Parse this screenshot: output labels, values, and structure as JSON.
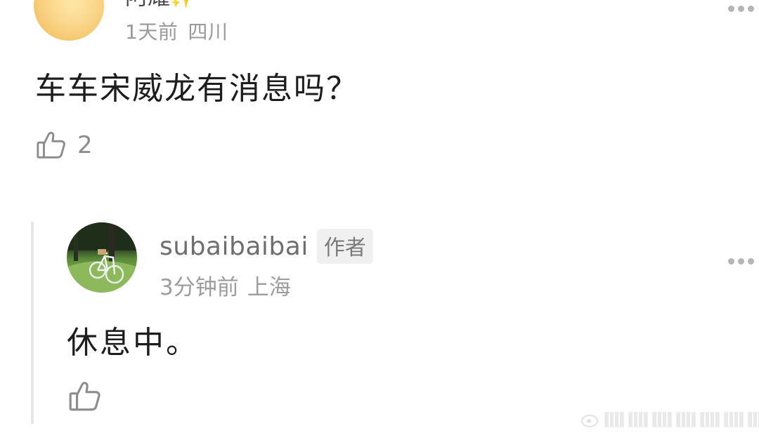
{
  "top_comment": {
    "username": "阿耀",
    "username_suffix": "✨",
    "time": "1天前",
    "location": "四川",
    "text": "车车宋威龙有消息吗？",
    "like_count": "2"
  },
  "reply": {
    "username": "subaibaibai",
    "badge": "作者",
    "time": "3分钟前",
    "location": "上海",
    "text": "休息中。"
  },
  "colors": {
    "meta_gray": "#9a9a9a",
    "text_dark": "#1d1d1d",
    "icon_gray": "#8c8c8c",
    "reply_bar": "#e6e6e6"
  }
}
